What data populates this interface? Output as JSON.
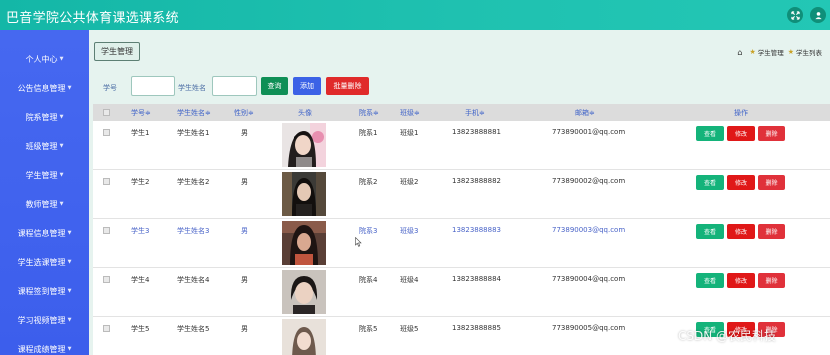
{
  "header": {
    "title": "巴音学院公共体育课选课系统"
  },
  "sidebar": {
    "items": [
      {
        "label": "个人中心"
      },
      {
        "label": "公告信息管理"
      },
      {
        "label": "院系管理"
      },
      {
        "label": "班级管理"
      },
      {
        "label": "学生管理"
      },
      {
        "label": "教师管理"
      },
      {
        "label": "课程信息管理"
      },
      {
        "label": "学生选课管理"
      },
      {
        "label": "课程签到管理"
      },
      {
        "label": "学习视频管理"
      },
      {
        "label": "课程成绩管理"
      }
    ]
  },
  "main": {
    "tab_label": "学生管理",
    "breadcrumb": [
      "学生管理",
      "学生列表"
    ],
    "search": {
      "student_no_label": "学号",
      "student_no_value": "",
      "student_name_label": "学生姓名",
      "student_name_value": "",
      "search_button": "查询",
      "add_button": "添加",
      "batch_delete_button": "批量删除"
    },
    "table": {
      "headers": [
        "学号",
        "学生姓名",
        "性别",
        "头像",
        "院系",
        "班级",
        "手机",
        "邮箱",
        "操作"
      ],
      "sort_marker": "≑",
      "rows": [
        {
          "no": "学生1",
          "name": "学生姓名1",
          "gender": "男",
          "dept": "院系1",
          "class": "班级1",
          "phone": "13823888881",
          "email": "773890001@qq.com"
        },
        {
          "no": "学生2",
          "name": "学生姓名2",
          "gender": "男",
          "dept": "院系2",
          "class": "班级2",
          "phone": "13823888882",
          "email": "773890002@qq.com"
        },
        {
          "no": "学生3",
          "name": "学生姓名3",
          "gender": "男",
          "dept": "院系3",
          "class": "班级3",
          "phone": "13823888883",
          "email": "773890003@qq.com"
        },
        {
          "no": "学生4",
          "name": "学生姓名4",
          "gender": "男",
          "dept": "院系4",
          "class": "班级4",
          "phone": "13823888884",
          "email": "773890004@qq.com"
        },
        {
          "no": "学生5",
          "name": "学生姓名5",
          "gender": "男",
          "dept": "院系5",
          "class": "班级5",
          "phone": "13823888885",
          "email": "773890005@qq.com"
        }
      ],
      "actions": {
        "view": "查看",
        "edit": "修改",
        "delete": "删除"
      }
    }
  },
  "watermark": "CSDN @农民科技",
  "colors": {
    "header": "#1fc1b0",
    "sidebar": "#4466ee",
    "search_button": "#0f8f56",
    "add_button": "#3b62e6",
    "danger": "#e01818",
    "view_button": "#14b37a"
  }
}
